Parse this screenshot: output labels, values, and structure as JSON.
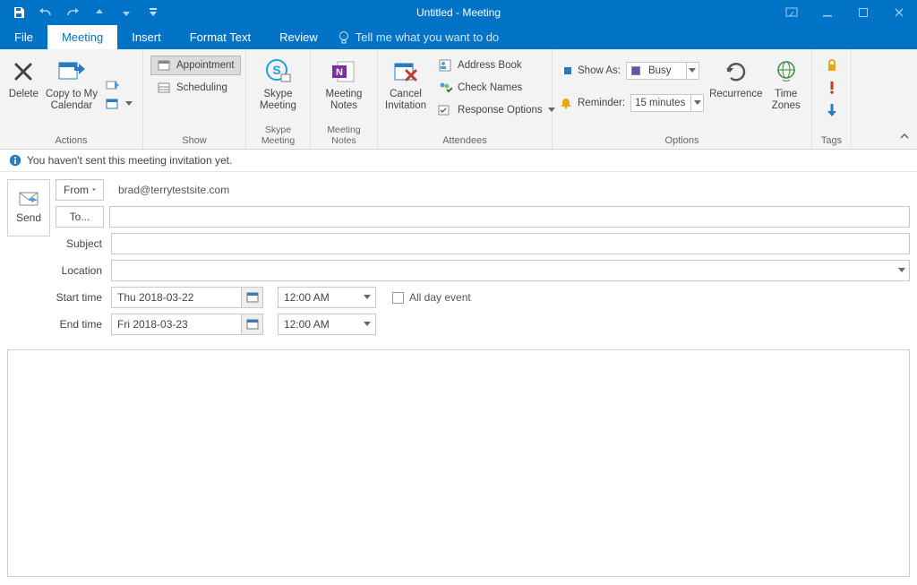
{
  "title": "Untitled  -  Meeting",
  "qat": {
    "save": "save",
    "undo": "undo",
    "redo": "redo",
    "prev": "prev",
    "next": "next",
    "more": "more"
  },
  "tabs": {
    "file": "File",
    "meeting": "Meeting",
    "insert": "Insert",
    "format_text": "Format Text",
    "review": "Review",
    "tell_me": "Tell me what you want to do"
  },
  "ribbon": {
    "actions": {
      "label": "Actions",
      "delete": "Delete",
      "copy_to_calendar": "Copy to My\nCalendar"
    },
    "show": {
      "label": "Show",
      "appointment": "Appointment",
      "scheduling": "Scheduling"
    },
    "skype": {
      "label": "Skype Meeting",
      "button": "Skype\nMeeting"
    },
    "meeting_notes": {
      "label": "Meeting Notes",
      "button": "Meeting\nNotes"
    },
    "attendees": {
      "label": "Attendees",
      "cancel": "Cancel\nInvitation",
      "address_book": "Address Book",
      "check_names": "Check Names",
      "response_options": "Response Options"
    },
    "options": {
      "label": "Options",
      "show_as_label": "Show As:",
      "show_as_value": "Busy",
      "reminder_label": "Reminder:",
      "reminder_value": "15 minutes",
      "recurrence": "Recurrence",
      "time_zones": "Time\nZones"
    },
    "tags": {
      "label": "Tags"
    }
  },
  "info_bar": "You haven't sent this meeting invitation yet.",
  "form": {
    "send": "Send",
    "from_label": "From",
    "from_value": "brad@terrytestsite.com",
    "to_label": "To...",
    "to_value": "",
    "subject_label": "Subject",
    "subject_value": "",
    "location_label": "Location",
    "location_value": "",
    "start_label": "Start time",
    "start_date": "Thu 2018-03-22",
    "start_time": "12:00 AM",
    "all_day": "All day event",
    "end_label": "End time",
    "end_date": "Fri 2018-03-23",
    "end_time": "12:00 AM"
  }
}
